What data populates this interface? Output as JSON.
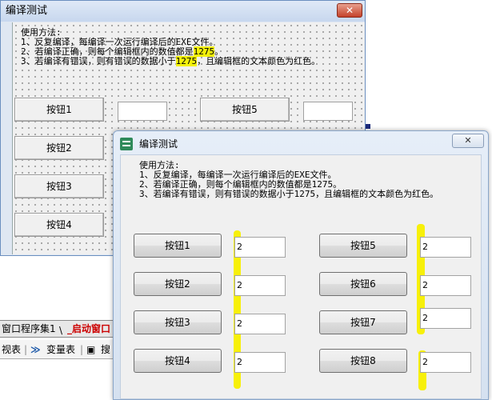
{
  "back_window": {
    "title": "编译测试",
    "close_glyph": "✕",
    "instructions": {
      "heading": "使用方法:",
      "line1": "1、反复编译，每编译一次运行编译后的EXE文件。",
      "line2_prefix": "2、若编译正确，则每个编辑框内的数值都是",
      "line2_value": "1275",
      "line2_suffix": "。",
      "line3_prefix": "3、若编译有错误，则有错误的数据小于",
      "line3_value": "1275",
      "line3_suffix": "，且编辑框的文本颜色为红色。"
    },
    "buttons": [
      "按钮1",
      "按钮2",
      "按钮3",
      "按钮4",
      "按钮5"
    ]
  },
  "ide": {
    "tab_program_set": "窗口程序集1",
    "tab_separator": "\\",
    "tab_startup_window": "_启动窗口",
    "toolbar_view": "视表",
    "toolbar_variables": "变量表",
    "toolbar_search": "搜"
  },
  "front_window": {
    "title": "编译测试",
    "close_glyph": "✕",
    "instructions": {
      "heading": "使用方法:",
      "line1": "1、反复编译，每编译一次运行编译后的EXE文件。",
      "line2": "2、若编译正确，则每个编辑框内的数值都是1275。",
      "line3": "3、若编译有错误，则有错误的数据小于1275，且编辑框的文本颜色为红色。"
    },
    "buttons": [
      "按钮1",
      "按钮2",
      "按钮3",
      "按钮4",
      "按钮5",
      "按钮6",
      "按钮7",
      "按钮8"
    ],
    "edit_values": [
      "2",
      "2",
      "2",
      "2",
      "2",
      "2",
      "2",
      "2"
    ]
  },
  "colors": {
    "highlight": "#f3f10a",
    "title_bar": "#d5e1f0",
    "error_text": "#cc0000"
  }
}
